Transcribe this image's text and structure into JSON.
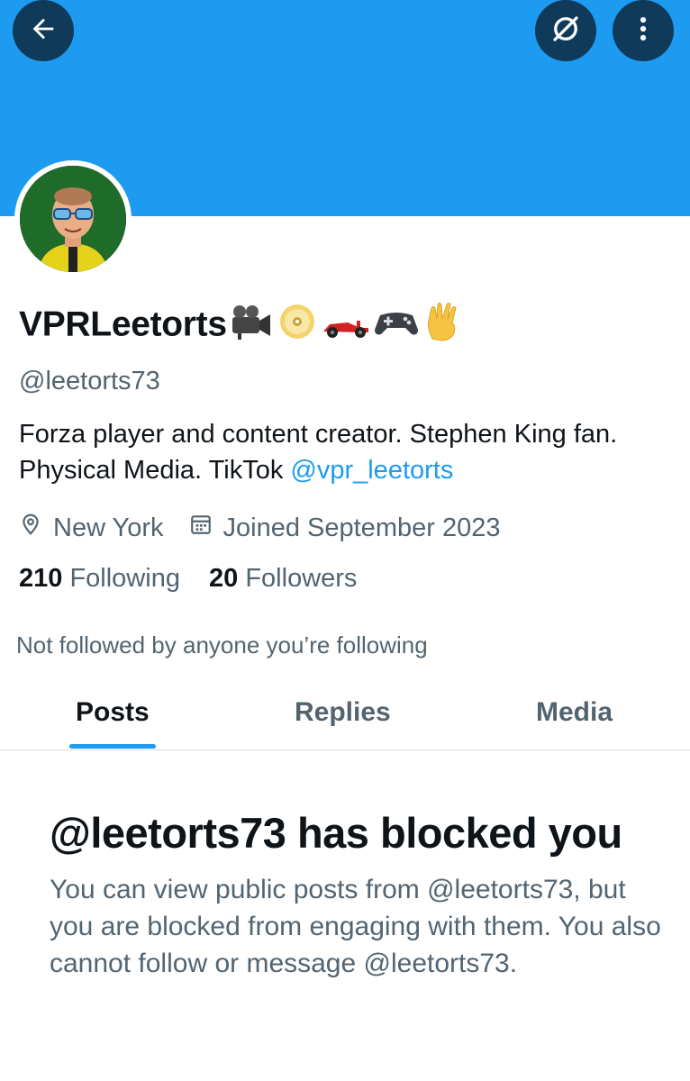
{
  "header": {
    "back_icon": "arrow-left-icon",
    "no_translate_icon": "slashed-circle-icon",
    "more_icon": "more-vertical-icon",
    "banner_color": "#1d9bf0"
  },
  "profile": {
    "display_name": "VPRLeetorts",
    "name_emojis": [
      "movie-camera-icon",
      "dvd-icon",
      "race-car-icon",
      "game-controller-icon",
      "vulcan-salute-icon"
    ],
    "handle": "@leetorts73",
    "bio_text": "Forza player and content creator. Stephen King fan. Physical Media.  TikTok ",
    "bio_link": "@vpr_leetorts",
    "location": "New York",
    "joined": "Joined September 2023",
    "following_count": "210",
    "following_label": "Following",
    "followers_count": "20",
    "followers_label": "Followers",
    "not_followed_text": "Not followed by anyone you’re following"
  },
  "tabs": [
    {
      "label": "Posts",
      "active": true
    },
    {
      "label": "Replies",
      "active": false
    },
    {
      "label": "Media",
      "active": false
    }
  ],
  "blocked": {
    "title": "@leetorts73 has blocked you",
    "body": "You can view public posts from @leetorts73, but you are blocked from engaging with them. You also cannot follow or message @leetorts73."
  },
  "colors": {
    "accent": "#1d9bf0",
    "text": "#0f1419",
    "muted": "#536471"
  }
}
